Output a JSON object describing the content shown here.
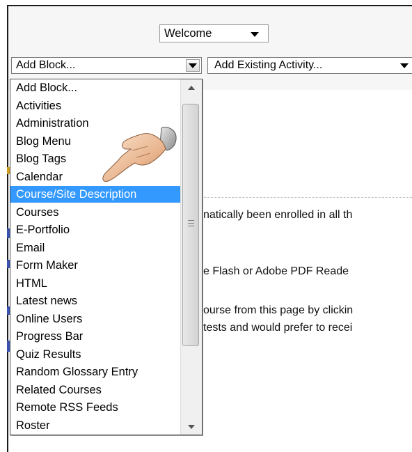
{
  "welcome_select": {
    "value": "Welcome"
  },
  "add_block_select": {
    "value": "Add Block..."
  },
  "add_activity_select": {
    "value": "Add Existing Activity..."
  },
  "dropdown": {
    "options": [
      "Add Block...",
      "Activities",
      "Administration",
      "Blog Menu",
      "Blog Tags",
      "Calendar",
      "Course/Site Description",
      "Courses",
      "E-Portfolio",
      "Email",
      "Form Maker",
      "HTML",
      "Latest news",
      "Online Users",
      "Progress Bar",
      "Quiz Results",
      "Random Glossary Entry",
      "Related Courses",
      "Remote RSS Feeds",
      "Roster"
    ],
    "selected": "Course/Site Description"
  },
  "background_text": {
    "line1": "natically been enrolled in all th",
    "line2": "e Flash or Adobe PDF Reade",
    "line3": "ourse from this page by clickin",
    "line4": "tests and would prefer to recei"
  },
  "colors": {
    "selection": "#3399ff",
    "accent_gold": "#cfa020",
    "accent_blue": "#3a52b0"
  },
  "icons": [
    "pointing-hand-cursor",
    "chevron-down-icon",
    "scroll-up-arrow",
    "scroll-down-arrow"
  ]
}
